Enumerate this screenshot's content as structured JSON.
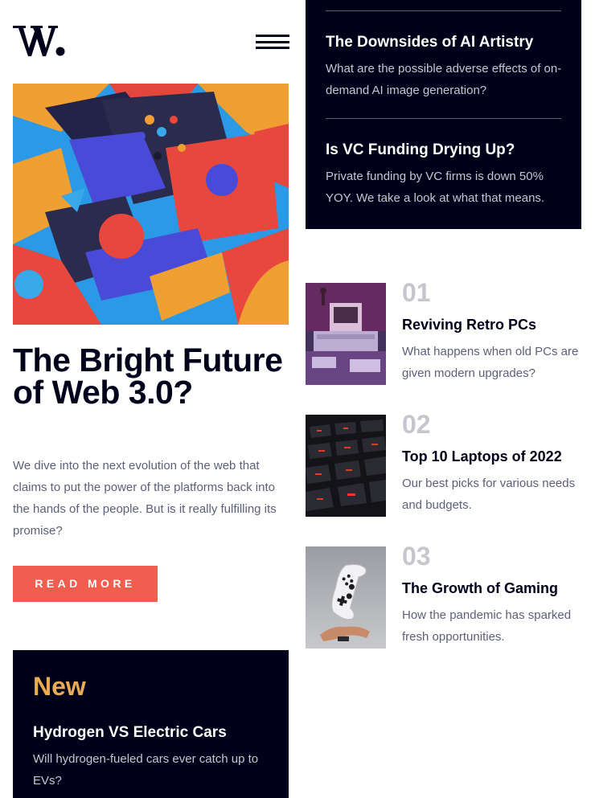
{
  "header": {
    "logo_text": "W.",
    "menu_icon": "hamburger-menu-icon"
  },
  "hero": {
    "image_icon": "abstract-3d-blocks-image",
    "title": "The Bright Future of Web 3.0?",
    "description": "We dive into the next evolution of the web that claims to put the power of the platforms back into the hands of the people. But is it really fulfilling its promise?",
    "button_label": "READ MORE"
  },
  "new_section": {
    "heading": "New",
    "items": [
      {
        "title": "Hydrogen VS Electric Cars",
        "description": "Will hydrogen-fueled cars ever catch up to EVs?"
      },
      {
        "title": "The Downsides of AI Artistry",
        "description": "What are the possible adverse effects of on-demand AI image generation?"
      },
      {
        "title": "Is VC Funding Drying Up?",
        "description": "Private funding by VC firms is down 50% YOY. We take a look at what that means."
      }
    ]
  },
  "articles": [
    {
      "number": "01",
      "title": "Reviving Retro PCs",
      "description": "What happens when old PCs are given modern upgrades?"
    },
    {
      "number": "02",
      "title": "Top 10 Laptops of 2022",
      "description": "Our best picks for various needs and budgets."
    },
    {
      "number": "03",
      "title": "The Growth of Gaming",
      "description": "How the pandemic has sparked fresh opportunities."
    }
  ],
  "colors": {
    "accent": "#f15e50",
    "dark": "#00001a",
    "gold": "#e9ab53",
    "muted": "#5d5f79",
    "light_muted": "#c5c6ce"
  }
}
